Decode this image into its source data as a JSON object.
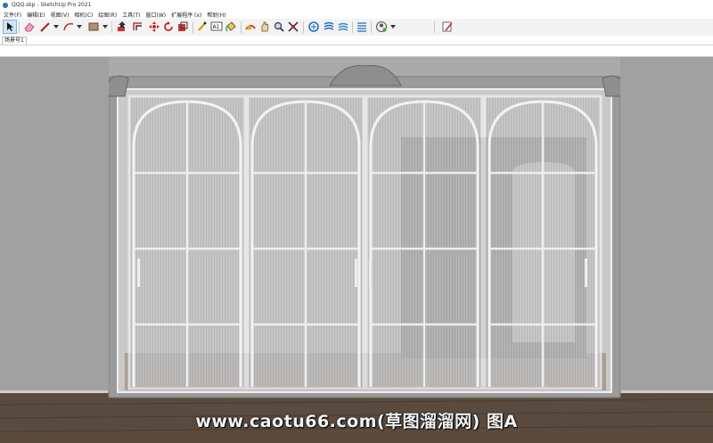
{
  "window": {
    "title": "QQQ.skp - SketchUp Pro 2021"
  },
  "menu": [
    {
      "label": "文件(F)"
    },
    {
      "label": "编辑(E)"
    },
    {
      "label": "视图(V)"
    },
    {
      "label": "相机(C)"
    },
    {
      "label": "绘图(R)"
    },
    {
      "label": "工具(T)"
    },
    {
      "label": "窗口(W)"
    },
    {
      "label": "扩展程序 (x)"
    },
    {
      "label": "帮助(H)"
    }
  ],
  "toolbar": {
    "tools": [
      {
        "icon": "select-arrow-icon",
        "name": "select"
      },
      {
        "icon": "eraser-icon",
        "name": "eraser"
      },
      {
        "icon": "pencil-line-icon",
        "name": "line"
      },
      {
        "icon": "arc-icon",
        "name": "arc"
      },
      {
        "icon": "rectangle-shape-icon",
        "name": "shapes"
      },
      {
        "icon": "push-pull-icon",
        "name": "push-pull"
      },
      {
        "icon": "offset-icon",
        "name": "offset"
      },
      {
        "icon": "move-icon",
        "name": "move"
      },
      {
        "icon": "rotate-icon",
        "name": "rotate"
      },
      {
        "icon": "scale-icon",
        "name": "scale"
      },
      {
        "icon": "tape-measure-icon",
        "name": "tape-measure"
      },
      {
        "icon": "text-icon",
        "name": "text"
      },
      {
        "icon": "paint-bucket-icon",
        "name": "paint-bucket"
      },
      {
        "icon": "orbit-icon",
        "name": "orbit"
      },
      {
        "icon": "pan-icon",
        "name": "pan"
      },
      {
        "icon": "zoom-icon",
        "name": "zoom"
      },
      {
        "icon": "zoom-extents-icon",
        "name": "zoom-extents"
      },
      {
        "icon": "warehouse-icon",
        "name": "3d-warehouse"
      },
      {
        "icon": "extension-warehouse-icon",
        "name": "extension-warehouse"
      },
      {
        "icon": "layout-icon",
        "name": "layout"
      },
      {
        "icon": "extension-manager-icon",
        "name": "extension-manager"
      },
      {
        "icon": "profile-icon",
        "name": "profile"
      },
      {
        "icon": "edit-note-icon",
        "name": "edit"
      }
    ],
    "text_icon_label": "A1"
  },
  "scene_tab": {
    "label": "场景号1"
  },
  "watermark": {
    "text": "www.caotu66.com(草图溜溜网) 图A"
  },
  "colors": {
    "wall": "#a9a9a9",
    "wall_shadow": "#999999",
    "floor": "#5a4a3e",
    "frame": "#d8d8d8",
    "glass": "#c2c2c2",
    "mullion": "#eeeeee",
    "shadow_inner": "#7e7e7e"
  },
  "model": {
    "door_panels": 4
  }
}
